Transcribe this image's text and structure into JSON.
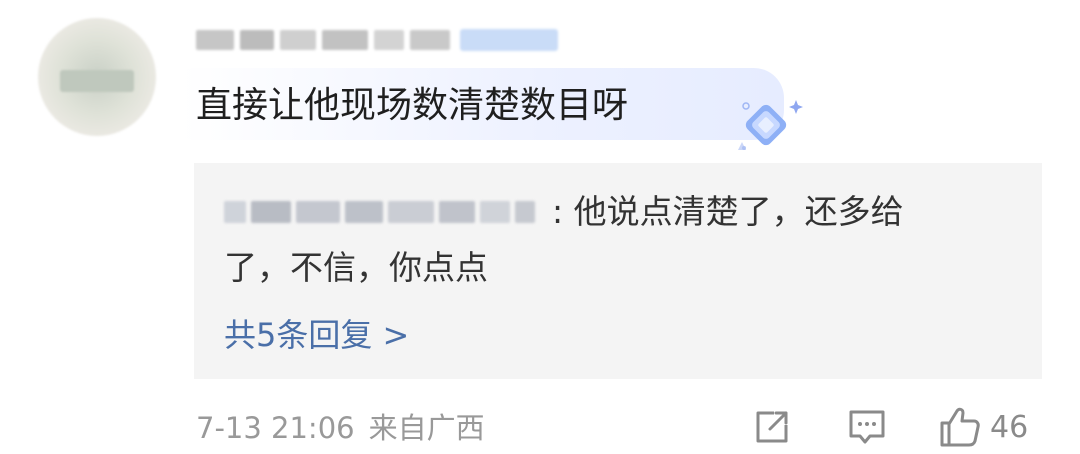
{
  "comment": {
    "text": "直接让他现场数清楚数目呀",
    "avatar_icon": "blurred-avatar",
    "username_icon": "pixelated-username",
    "badge_icon": "blue-diamond-badge-icon"
  },
  "reply": {
    "user_icon": "pixelated-reply-username",
    "text_line1": ": 他说点清楚了，还多给",
    "text_line2": "了，不信，你点点",
    "more_link": "共5条回复 >"
  },
  "footer": {
    "date": "7-13 21:06",
    "location": "来自广西",
    "like_count": "46",
    "icons": [
      "share-icon",
      "comment-icon",
      "like-icon"
    ]
  },
  "colors": {
    "link_blue": "#4a6fa8",
    "meta_gray": "#999999",
    "reply_bg": "#f4f4f4",
    "bubble_tint": "#edf1ff"
  }
}
